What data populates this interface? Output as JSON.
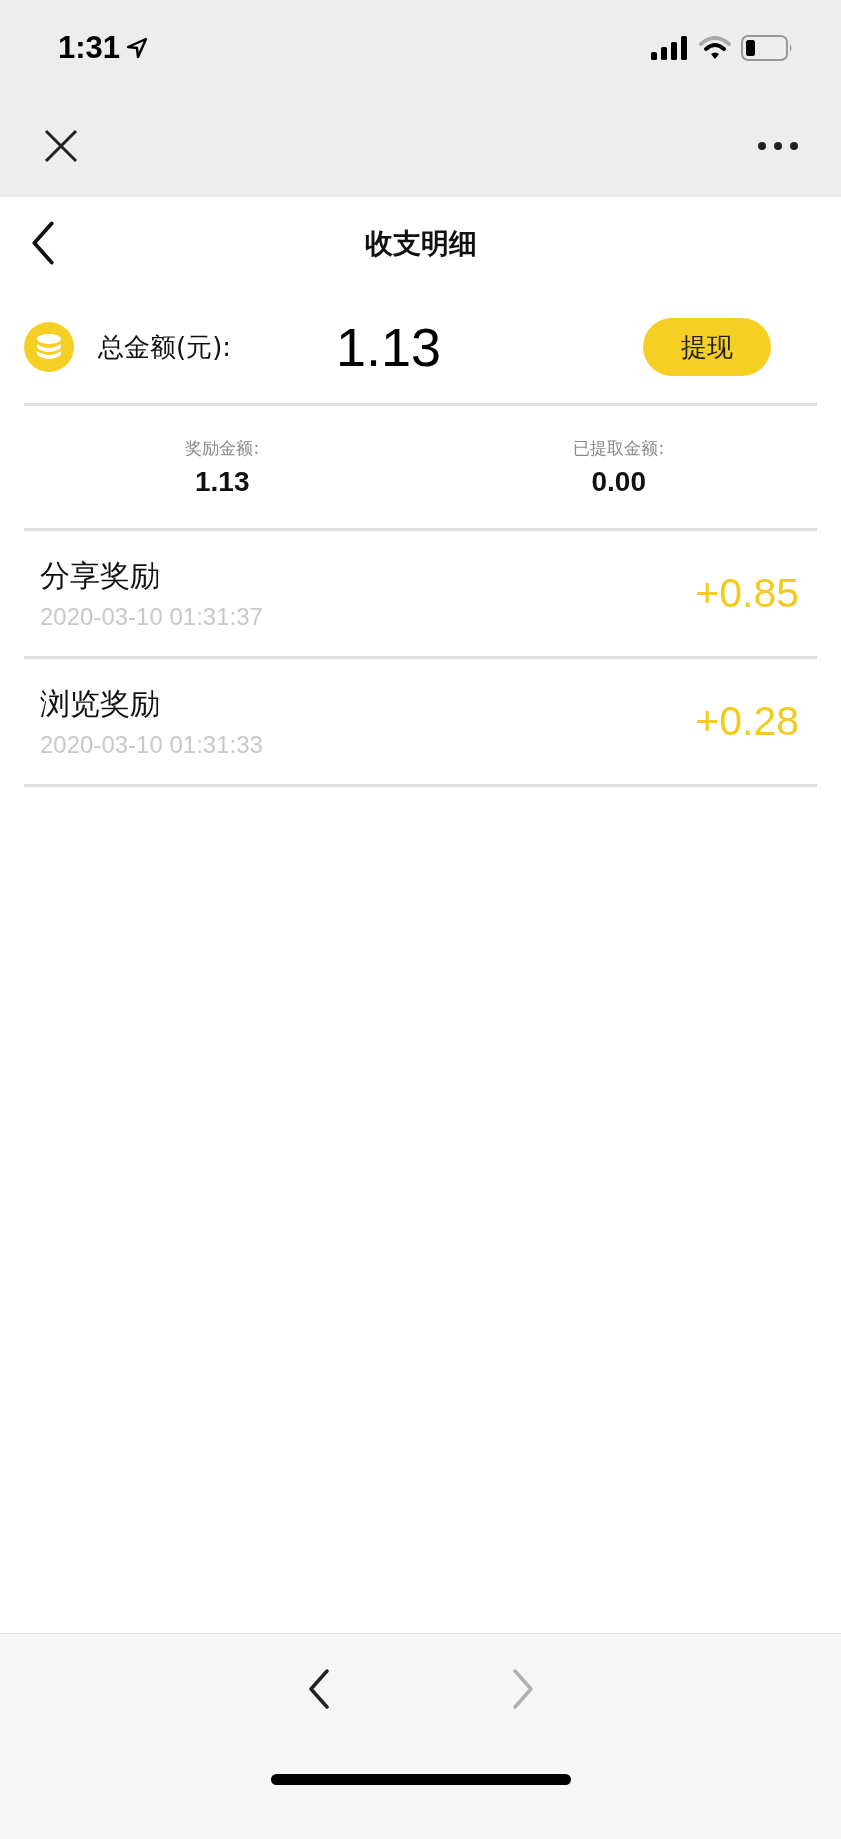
{
  "status_bar": {
    "time": "1:31"
  },
  "header": {
    "title": "收支明细"
  },
  "summary": {
    "label": "总金额(元):",
    "amount": "1.13",
    "button": "提现"
  },
  "stats": [
    {
      "label": "奖励金额:",
      "value": "1.13"
    },
    {
      "label": "已提取金额:",
      "value": "0.00"
    }
  ],
  "records": [
    {
      "title": "分享奖励",
      "time": "2020-03-10 01:31:37",
      "amount": "+0.85"
    },
    {
      "title": "浏览奖励",
      "time": "2020-03-10 01:31:33",
      "amount": "+0.28"
    }
  ],
  "toolbar": [
    {
      "kind": "back",
      "disabled": false
    },
    {
      "kind": "forward",
      "disabled": true
    }
  ]
}
